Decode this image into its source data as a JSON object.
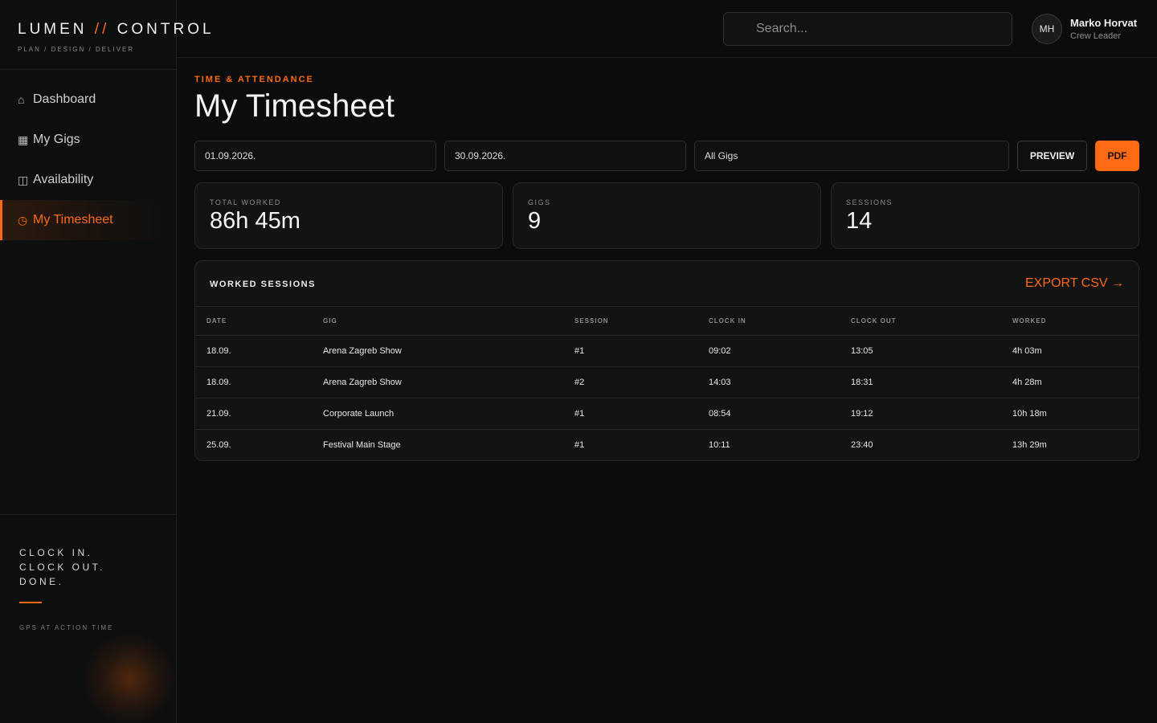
{
  "brand": {
    "name_left": "LUMEN",
    "separator": "//",
    "name_right": "CONTROL",
    "subtitle": "PLAN / DESIGN / DELIVER",
    "accent_color": "#ff6a13"
  },
  "sidebar": {
    "items": [
      {
        "icon": "home-icon",
        "glyph": "⌂",
        "label": "Dashboard",
        "active": false
      },
      {
        "icon": "grid-icon",
        "glyph": "▦",
        "label": "My Gigs",
        "active": false
      },
      {
        "icon": "calendar-icon",
        "glyph": "◫",
        "label": "Availability",
        "active": false
      },
      {
        "icon": "clock-icon",
        "glyph": "◷",
        "label": "My Timesheet",
        "active": true
      }
    ],
    "tagline": [
      "CLOCK IN.",
      "CLOCK OUT.",
      "DONE."
    ],
    "note": "GPS AT ACTION TIME"
  },
  "header": {
    "search_placeholder": "Search...",
    "user": {
      "initials": "MH",
      "name": "Marko Horvat",
      "role": "Crew Leader"
    }
  },
  "page": {
    "eyebrow": "TIME & ATTENDANCE",
    "title": "My Timesheet"
  },
  "filters": {
    "date_from": "01.09.2026.",
    "date_to": "30.09.2026.",
    "gig_filter": "All Gigs",
    "preview_label": "PREVIEW",
    "pdf_label": "PDF"
  },
  "stats": [
    {
      "label": "TOTAL WORKED",
      "value": "86h 45m"
    },
    {
      "label": "GIGS",
      "value": "9"
    },
    {
      "label": "SESSIONS",
      "value": "14"
    }
  ],
  "sessions": {
    "title": "WORKED SESSIONS",
    "export_label": "EXPORT CSV →",
    "columns": [
      "DATE",
      "GIG",
      "SESSION",
      "CLOCK IN",
      "CLOCK OUT",
      "WORKED"
    ],
    "rows": [
      [
        "18.09.",
        "Arena Zagreb Show",
        "#1",
        "09:02",
        "13:05",
        "4h 03m"
      ],
      [
        "18.09.",
        "Arena Zagreb Show",
        "#2",
        "14:03",
        "18:31",
        "4h 28m"
      ],
      [
        "21.09.",
        "Corporate Launch",
        "#1",
        "08:54",
        "19:12",
        "10h 18m"
      ],
      [
        "25.09.",
        "Festival Main Stage",
        "#1",
        "10:11",
        "23:40",
        "13h 29m"
      ]
    ]
  }
}
